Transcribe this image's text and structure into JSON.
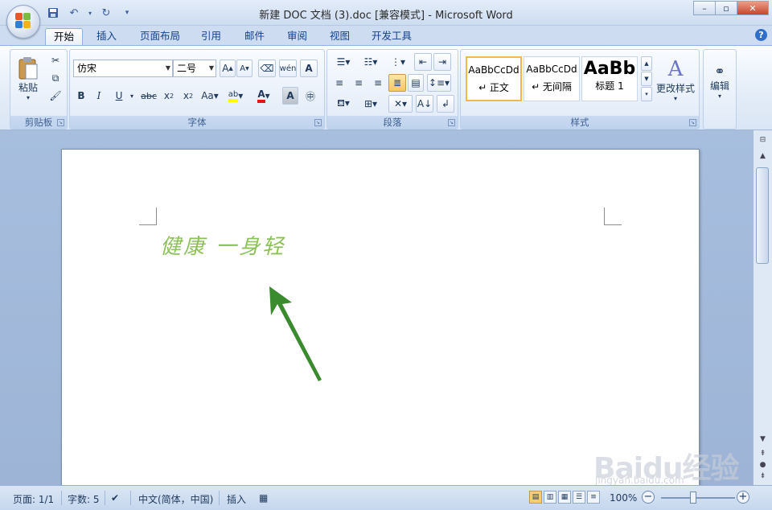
{
  "window": {
    "title": "新建 DOC 文档 (3).doc [兼容模式] - Microsoft Word",
    "minimize": "–",
    "restore": "▫",
    "close": "✕"
  },
  "qat": {
    "save_icon": "save-icon",
    "undo_icon": "undo-icon",
    "redo_icon": "redo-icon",
    "customize_icon": "dropdown-icon"
  },
  "tabs": [
    {
      "label": "开始",
      "active": true
    },
    {
      "label": "插入"
    },
    {
      "label": "页面布局"
    },
    {
      "label": "引用"
    },
    {
      "label": "邮件"
    },
    {
      "label": "审阅"
    },
    {
      "label": "视图"
    },
    {
      "label": "开发工具"
    }
  ],
  "ribbon": {
    "clipboard": {
      "label": "剪贴板",
      "paste": "粘贴"
    },
    "font": {
      "label": "字体",
      "font_name": "仿宋",
      "font_size": "二号"
    },
    "paragraph": {
      "label": "段落"
    },
    "styles": {
      "label": "样式",
      "items": [
        {
          "sample": "AaBbCcDd",
          "name": "↵ 正文"
        },
        {
          "sample": "AaBbCcDd",
          "name": "↵ 无间隔"
        },
        {
          "sample": "AaBb",
          "name": "标题 1"
        }
      ],
      "change_styles": "更改样式"
    },
    "editing": {
      "label": "编辑"
    }
  },
  "document": {
    "text": "健康 一身轻"
  },
  "statusbar": {
    "page": "页面: 1/1",
    "words": "字数: 5",
    "language": "中文(简体，中国)",
    "mode": "插入",
    "zoom": "100%"
  },
  "watermark": {
    "brand": "Baidu经验",
    "url": "jingyan.baidu.com"
  },
  "colors": {
    "doc_text": "#8cc159",
    "arrow": "#3a8a2e"
  }
}
